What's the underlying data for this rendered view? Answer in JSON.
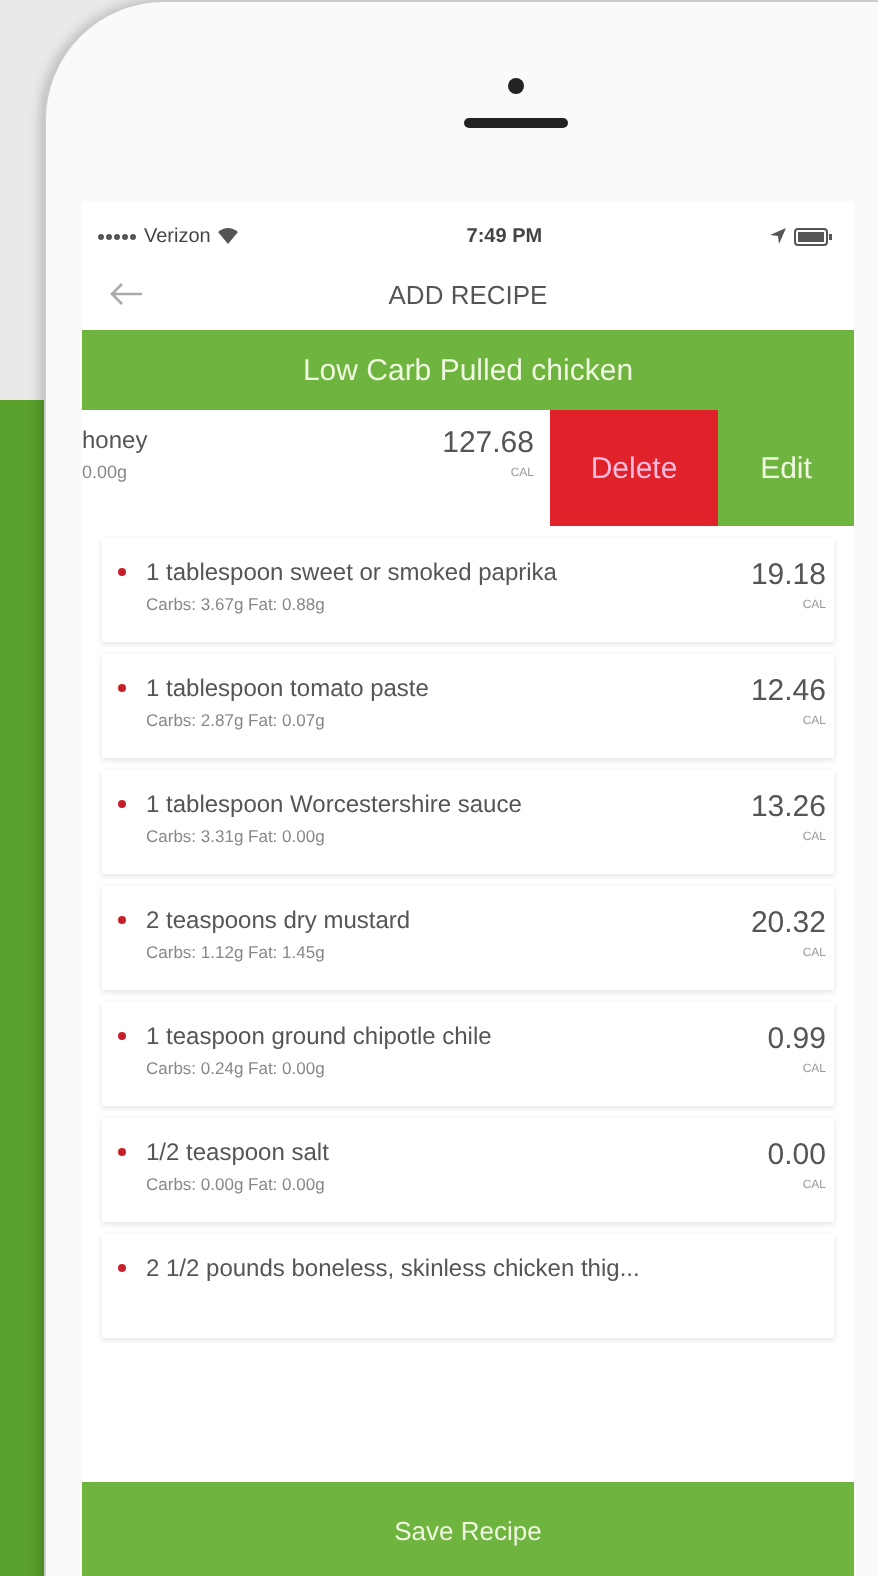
{
  "status_bar": {
    "carrier": "Verizon",
    "time": "7:49 PM"
  },
  "header": {
    "title": "ADD RECIPE"
  },
  "recipe_title": "Low Carb Pulled chicken",
  "swiped_row": {
    "name": "honey",
    "nutrition": "0.00g",
    "calories": "127.68",
    "unit": "CAL",
    "actions": [
      {
        "label": "Delete",
        "kind": "delete"
      },
      {
        "label": "Edit",
        "kind": "edit"
      }
    ]
  },
  "ingredients": [
    {
      "name": "1 tablespoon sweet or smoked paprika",
      "nutrition": "Carbs: 3.67g  Fat: 0.88g",
      "calories": "19.18",
      "unit": "CAL"
    },
    {
      "name": "1 tablespoon tomato paste",
      "nutrition": "Carbs: 2.87g  Fat: 0.07g",
      "calories": "12.46",
      "unit": "CAL"
    },
    {
      "name": "1 tablespoon Worcestershire sauce",
      "nutrition": "Carbs: 3.31g  Fat: 0.00g",
      "calories": "13.26",
      "unit": "CAL"
    },
    {
      "name": "2 teaspoons dry mustard",
      "nutrition": "Carbs: 1.12g  Fat: 1.45g",
      "calories": "20.32",
      "unit": "CAL"
    },
    {
      "name": "1 teaspoon ground chipotle chile",
      "nutrition": "Carbs: 0.24g  Fat: 0.00g",
      "calories": "0.99",
      "unit": "CAL"
    },
    {
      "name": "1/2 teaspoon salt",
      "nutrition": "Carbs: 0.00g  Fat: 0.00g",
      "calories": "0.00",
      "unit": "CAL"
    },
    {
      "name": "2 1/2 pounds boneless, skinless chicken thig..."
    }
  ],
  "save_button": "Save Recipe"
}
